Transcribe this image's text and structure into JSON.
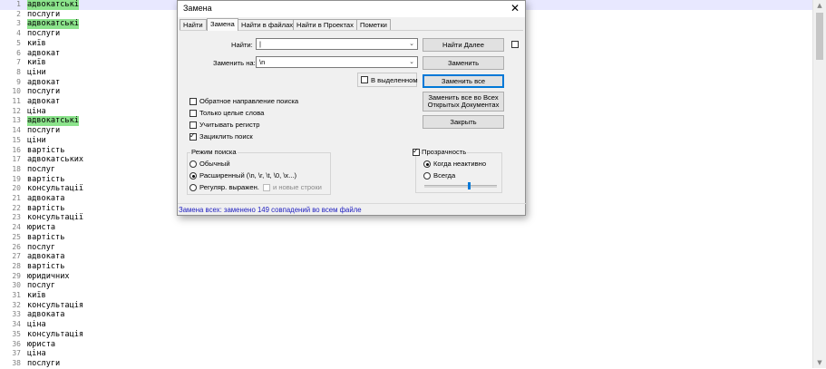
{
  "editor": {
    "lines": [
      {
        "n": "1",
        "t": "адвокатські",
        "hl": true
      },
      {
        "n": "2",
        "t": "послуги"
      },
      {
        "n": "3",
        "t": "адвокатські",
        "hl": true
      },
      {
        "n": "4",
        "t": "послуги"
      },
      {
        "n": "5",
        "t": "київ"
      },
      {
        "n": "6",
        "t": "адвокат"
      },
      {
        "n": "7",
        "t": "київ"
      },
      {
        "n": "8",
        "t": "ціни"
      },
      {
        "n": "9",
        "t": "адвокат"
      },
      {
        "n": "10",
        "t": "послуги"
      },
      {
        "n": "11",
        "t": "адвокат"
      },
      {
        "n": "12",
        "t": "ціна"
      },
      {
        "n": "13",
        "t": "адвокатські",
        "hl": true
      },
      {
        "n": "14",
        "t": "послуги"
      },
      {
        "n": "15",
        "t": "ціни"
      },
      {
        "n": "16",
        "t": "вартість"
      },
      {
        "n": "17",
        "t": "адвокатських"
      },
      {
        "n": "18",
        "t": "послуг"
      },
      {
        "n": "19",
        "t": "вартість"
      },
      {
        "n": "20",
        "t": "консультації"
      },
      {
        "n": "21",
        "t": "адвоката"
      },
      {
        "n": "22",
        "t": "вартість"
      },
      {
        "n": "23",
        "t": "консультації"
      },
      {
        "n": "24",
        "t": "юриста"
      },
      {
        "n": "25",
        "t": "вартість"
      },
      {
        "n": "26",
        "t": "послуг"
      },
      {
        "n": "27",
        "t": "адвоката"
      },
      {
        "n": "28",
        "t": "вартість"
      },
      {
        "n": "29",
        "t": "юридичних"
      },
      {
        "n": "30",
        "t": "послуг"
      },
      {
        "n": "31",
        "t": "київ"
      },
      {
        "n": "32",
        "t": "консультація"
      },
      {
        "n": "33",
        "t": "адвоката"
      },
      {
        "n": "34",
        "t": "ціна"
      },
      {
        "n": "35",
        "t": "консультація"
      },
      {
        "n": "36",
        "t": "юриста"
      },
      {
        "n": "37",
        "t": "ціна"
      },
      {
        "n": "38",
        "t": "послуги"
      }
    ],
    "highlight_color": "#8be38b",
    "current_line_color": "#e8e8ff"
  },
  "dialog": {
    "title": "Замена",
    "close_icon": "close-icon",
    "tabs": [
      "Найти",
      "Замена",
      "Найти в файлах",
      "Найти в Проектах",
      "Пометки"
    ],
    "active_tab": 1,
    "find_label": "Найти:",
    "find_value": "|",
    "replace_label": "Заменить на:",
    "replace_value": "\\n",
    "in_selection_label": "В выделенном",
    "options": {
      "backward": "Обратное направление поиска",
      "whole_word": "Только целые слова",
      "match_case": "Учитывать регистр",
      "wrap": "Зациклить поиск"
    },
    "search_mode": {
      "title": "Режим поиска",
      "normal": "Обычный",
      "extended": "Расширенный (\\n, \\r, \\t, \\0, \\x...)",
      "regex": "Регуляр. выражен.",
      "newline": "и новые строки"
    },
    "transparency": {
      "title": "Прозрачность",
      "on_losing_focus": "Когда неактивно",
      "always": "Всегда",
      "level": 0.6
    },
    "buttons": {
      "find_next": "Найти Далее",
      "replace": "Заменить",
      "replace_all": "Заменить все",
      "replace_all_open_line1": "Заменить все во Всех",
      "replace_all_open_line2": "Открытых Документах",
      "close": "Закрыть"
    },
    "status": "Замена всех: заменено 149 совпадений во всем файле",
    "status_color": "#2020c0"
  }
}
